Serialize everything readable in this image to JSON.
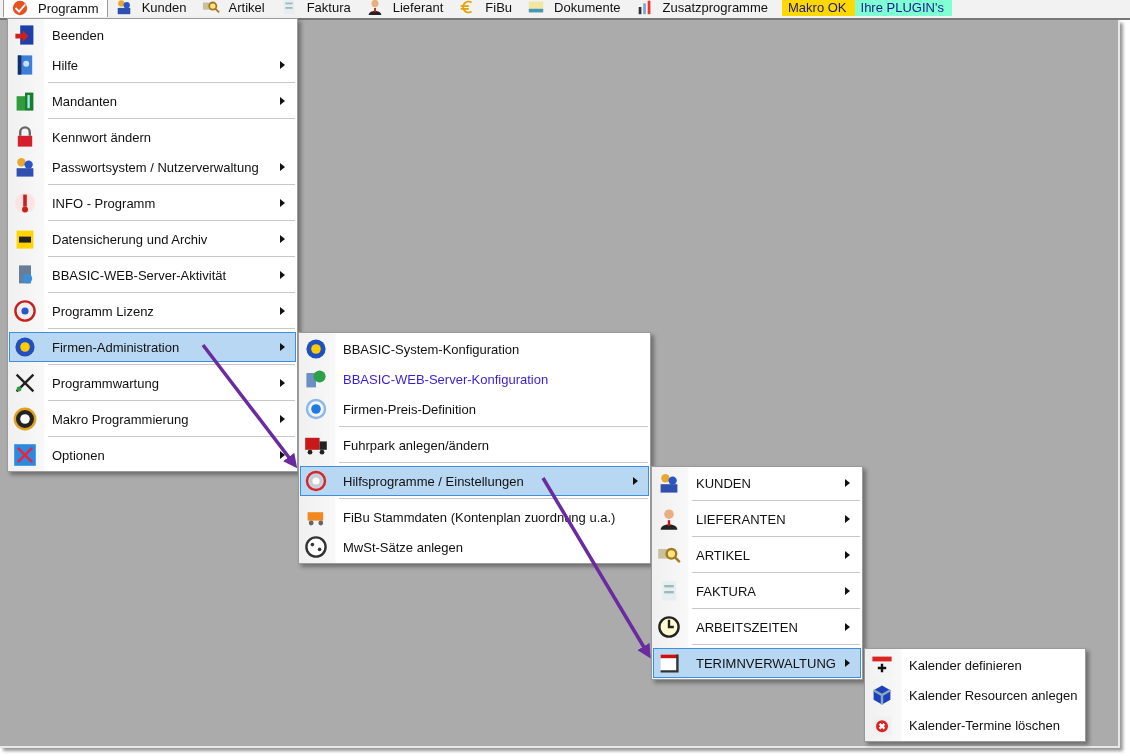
{
  "menubar": [
    {
      "label": "Programm",
      "selected": true
    },
    {
      "label": "Kunden",
      "selected": false
    },
    {
      "label": "Artikel",
      "selected": false
    },
    {
      "label": "Faktura",
      "selected": false
    },
    {
      "label": "Lieferant",
      "selected": false
    },
    {
      "label": "FiBu",
      "selected": false
    },
    {
      "label": "Dokumente",
      "selected": false
    },
    {
      "label": "Zusatzprogramme",
      "selected": false
    },
    {
      "label": "Makro OK",
      "selected": false,
      "color": "#ffd800"
    },
    {
      "label": "Ihre PLUGIN's",
      "selected": false,
      "color": "#80ffd4"
    }
  ],
  "menus": [
    {
      "items": [
        {
          "label": "Beenden",
          "has_submenu": false,
          "selected": false,
          "separator_before": false
        },
        {
          "label": "Hilfe",
          "has_submenu": true,
          "selected": false,
          "separator_before": false
        },
        {
          "label": "Mandanten",
          "has_submenu": true,
          "selected": false,
          "separator_before": true
        },
        {
          "label": "Kennwort ändern",
          "has_submenu": false,
          "selected": false,
          "separator_before": true
        },
        {
          "label": "Passwortsystem / Nutzerverwaltung",
          "has_submenu": true,
          "selected": false,
          "separator_before": false
        },
        {
          "label": "INFO - Programm",
          "has_submenu": true,
          "selected": false,
          "separator_before": true
        },
        {
          "label": "Datensicherung und Archiv",
          "has_submenu": true,
          "selected": false,
          "separator_before": true
        },
        {
          "label": "BBASIC-WEB-Server-Aktivität",
          "has_submenu": true,
          "selected": false,
          "separator_before": true
        },
        {
          "label": "Programm Lizenz",
          "has_submenu": true,
          "selected": false,
          "separator_before": true
        },
        {
          "label": "Firmen-Administration",
          "has_submenu": true,
          "selected": true,
          "separator_before": true
        },
        {
          "label": "Programmwartung",
          "has_submenu": true,
          "selected": false,
          "separator_before": true
        },
        {
          "label": "Makro Programmierung",
          "has_submenu": true,
          "selected": false,
          "separator_before": true
        },
        {
          "label": "Optionen",
          "has_submenu": true,
          "selected": false,
          "separator_before": true
        }
      ]
    },
    {
      "items": [
        {
          "label": "BBASIC-System-Konfiguration",
          "has_submenu": false,
          "selected": false,
          "separator_before": false
        },
        {
          "label": "BBASIC-WEB-Server-Konfiguration",
          "has_submenu": false,
          "selected": false,
          "separator_before": false,
          "color": "#3a1fd0"
        },
        {
          "label": "Firmen-Preis-Definition",
          "has_submenu": false,
          "selected": false,
          "separator_before": false
        },
        {
          "label": "Fuhrpark anlegen/ändern",
          "has_submenu": false,
          "selected": false,
          "separator_before": true
        },
        {
          "label": "Hilfsprogramme / Einstellungen",
          "has_submenu": true,
          "selected": true,
          "separator_before": true
        },
        {
          "label": "FiBu Stammdaten (Kontenplan zuordnung u.a.)",
          "has_submenu": false,
          "selected": false,
          "separator_before": true
        },
        {
          "label": "MwSt-Sätze anlegen",
          "has_submenu": false,
          "selected": false,
          "separator_before": false
        }
      ]
    },
    {
      "items": [
        {
          "label": "KUNDEN",
          "has_submenu": true,
          "selected": false,
          "separator_before": false
        },
        {
          "label": "LIEFERANTEN",
          "has_submenu": true,
          "selected": false,
          "separator_before": true
        },
        {
          "label": "ARTIKEL",
          "has_submenu": true,
          "selected": false,
          "separator_before": true
        },
        {
          "label": "FAKTURA",
          "has_submenu": true,
          "selected": false,
          "separator_before": true
        },
        {
          "label": "ARBEITSZEITEN",
          "has_submenu": true,
          "selected": false,
          "separator_before": true
        },
        {
          "label": "TERIMNVERWALTUNG",
          "has_submenu": true,
          "selected": true,
          "separator_before": true
        }
      ]
    },
    {
      "items": [
        {
          "label": "Kalender definieren",
          "has_submenu": false,
          "selected": false,
          "separator_before": false
        },
        {
          "label": "Kalender Resourcen anlegen",
          "has_submenu": false,
          "selected": false,
          "separator_before": false
        },
        {
          "label": "Kalender-Termine löschen",
          "has_submenu": false,
          "selected": false,
          "separator_before": false
        }
      ]
    }
  ]
}
